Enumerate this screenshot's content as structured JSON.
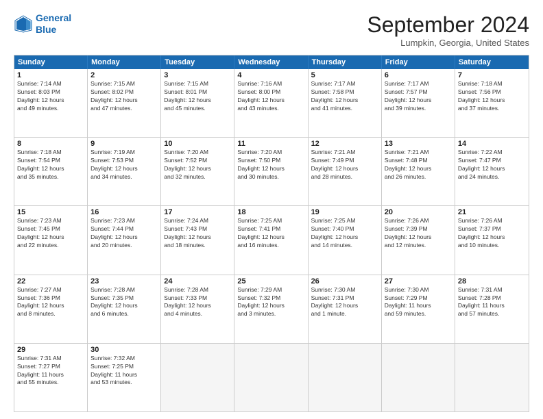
{
  "header": {
    "logo_line1": "General",
    "logo_line2": "Blue",
    "month": "September 2024",
    "location": "Lumpkin, Georgia, United States"
  },
  "weekdays": [
    "Sunday",
    "Monday",
    "Tuesday",
    "Wednesday",
    "Thursday",
    "Friday",
    "Saturday"
  ],
  "weeks": [
    [
      {
        "day": "1",
        "lines": [
          "Sunrise: 7:14 AM",
          "Sunset: 8:03 PM",
          "Daylight: 12 hours",
          "and 49 minutes."
        ]
      },
      {
        "day": "2",
        "lines": [
          "Sunrise: 7:15 AM",
          "Sunset: 8:02 PM",
          "Daylight: 12 hours",
          "and 47 minutes."
        ]
      },
      {
        "day": "3",
        "lines": [
          "Sunrise: 7:15 AM",
          "Sunset: 8:01 PM",
          "Daylight: 12 hours",
          "and 45 minutes."
        ]
      },
      {
        "day": "4",
        "lines": [
          "Sunrise: 7:16 AM",
          "Sunset: 8:00 PM",
          "Daylight: 12 hours",
          "and 43 minutes."
        ]
      },
      {
        "day": "5",
        "lines": [
          "Sunrise: 7:17 AM",
          "Sunset: 7:58 PM",
          "Daylight: 12 hours",
          "and 41 minutes."
        ]
      },
      {
        "day": "6",
        "lines": [
          "Sunrise: 7:17 AM",
          "Sunset: 7:57 PM",
          "Daylight: 12 hours",
          "and 39 minutes."
        ]
      },
      {
        "day": "7",
        "lines": [
          "Sunrise: 7:18 AM",
          "Sunset: 7:56 PM",
          "Daylight: 12 hours",
          "and 37 minutes."
        ]
      }
    ],
    [
      {
        "day": "8",
        "lines": [
          "Sunrise: 7:18 AM",
          "Sunset: 7:54 PM",
          "Daylight: 12 hours",
          "and 35 minutes."
        ]
      },
      {
        "day": "9",
        "lines": [
          "Sunrise: 7:19 AM",
          "Sunset: 7:53 PM",
          "Daylight: 12 hours",
          "and 34 minutes."
        ]
      },
      {
        "day": "10",
        "lines": [
          "Sunrise: 7:20 AM",
          "Sunset: 7:52 PM",
          "Daylight: 12 hours",
          "and 32 minutes."
        ]
      },
      {
        "day": "11",
        "lines": [
          "Sunrise: 7:20 AM",
          "Sunset: 7:50 PM",
          "Daylight: 12 hours",
          "and 30 minutes."
        ]
      },
      {
        "day": "12",
        "lines": [
          "Sunrise: 7:21 AM",
          "Sunset: 7:49 PM",
          "Daylight: 12 hours",
          "and 28 minutes."
        ]
      },
      {
        "day": "13",
        "lines": [
          "Sunrise: 7:21 AM",
          "Sunset: 7:48 PM",
          "Daylight: 12 hours",
          "and 26 minutes."
        ]
      },
      {
        "day": "14",
        "lines": [
          "Sunrise: 7:22 AM",
          "Sunset: 7:47 PM",
          "Daylight: 12 hours",
          "and 24 minutes."
        ]
      }
    ],
    [
      {
        "day": "15",
        "lines": [
          "Sunrise: 7:23 AM",
          "Sunset: 7:45 PM",
          "Daylight: 12 hours",
          "and 22 minutes."
        ]
      },
      {
        "day": "16",
        "lines": [
          "Sunrise: 7:23 AM",
          "Sunset: 7:44 PM",
          "Daylight: 12 hours",
          "and 20 minutes."
        ]
      },
      {
        "day": "17",
        "lines": [
          "Sunrise: 7:24 AM",
          "Sunset: 7:43 PM",
          "Daylight: 12 hours",
          "and 18 minutes."
        ]
      },
      {
        "day": "18",
        "lines": [
          "Sunrise: 7:25 AM",
          "Sunset: 7:41 PM",
          "Daylight: 12 hours",
          "and 16 minutes."
        ]
      },
      {
        "day": "19",
        "lines": [
          "Sunrise: 7:25 AM",
          "Sunset: 7:40 PM",
          "Daylight: 12 hours",
          "and 14 minutes."
        ]
      },
      {
        "day": "20",
        "lines": [
          "Sunrise: 7:26 AM",
          "Sunset: 7:39 PM",
          "Daylight: 12 hours",
          "and 12 minutes."
        ]
      },
      {
        "day": "21",
        "lines": [
          "Sunrise: 7:26 AM",
          "Sunset: 7:37 PM",
          "Daylight: 12 hours",
          "and 10 minutes."
        ]
      }
    ],
    [
      {
        "day": "22",
        "lines": [
          "Sunrise: 7:27 AM",
          "Sunset: 7:36 PM",
          "Daylight: 12 hours",
          "and 8 minutes."
        ]
      },
      {
        "day": "23",
        "lines": [
          "Sunrise: 7:28 AM",
          "Sunset: 7:35 PM",
          "Daylight: 12 hours",
          "and 6 minutes."
        ]
      },
      {
        "day": "24",
        "lines": [
          "Sunrise: 7:28 AM",
          "Sunset: 7:33 PM",
          "Daylight: 12 hours",
          "and 4 minutes."
        ]
      },
      {
        "day": "25",
        "lines": [
          "Sunrise: 7:29 AM",
          "Sunset: 7:32 PM",
          "Daylight: 12 hours",
          "and 3 minutes."
        ]
      },
      {
        "day": "26",
        "lines": [
          "Sunrise: 7:30 AM",
          "Sunset: 7:31 PM",
          "Daylight: 12 hours",
          "and 1 minute."
        ]
      },
      {
        "day": "27",
        "lines": [
          "Sunrise: 7:30 AM",
          "Sunset: 7:29 PM",
          "Daylight: 11 hours",
          "and 59 minutes."
        ]
      },
      {
        "day": "28",
        "lines": [
          "Sunrise: 7:31 AM",
          "Sunset: 7:28 PM",
          "Daylight: 11 hours",
          "and 57 minutes."
        ]
      }
    ],
    [
      {
        "day": "29",
        "lines": [
          "Sunrise: 7:31 AM",
          "Sunset: 7:27 PM",
          "Daylight: 11 hours",
          "and 55 minutes."
        ]
      },
      {
        "day": "30",
        "lines": [
          "Sunrise: 7:32 AM",
          "Sunset: 7:25 PM",
          "Daylight: 11 hours",
          "and 53 minutes."
        ]
      },
      null,
      null,
      null,
      null,
      null
    ]
  ]
}
